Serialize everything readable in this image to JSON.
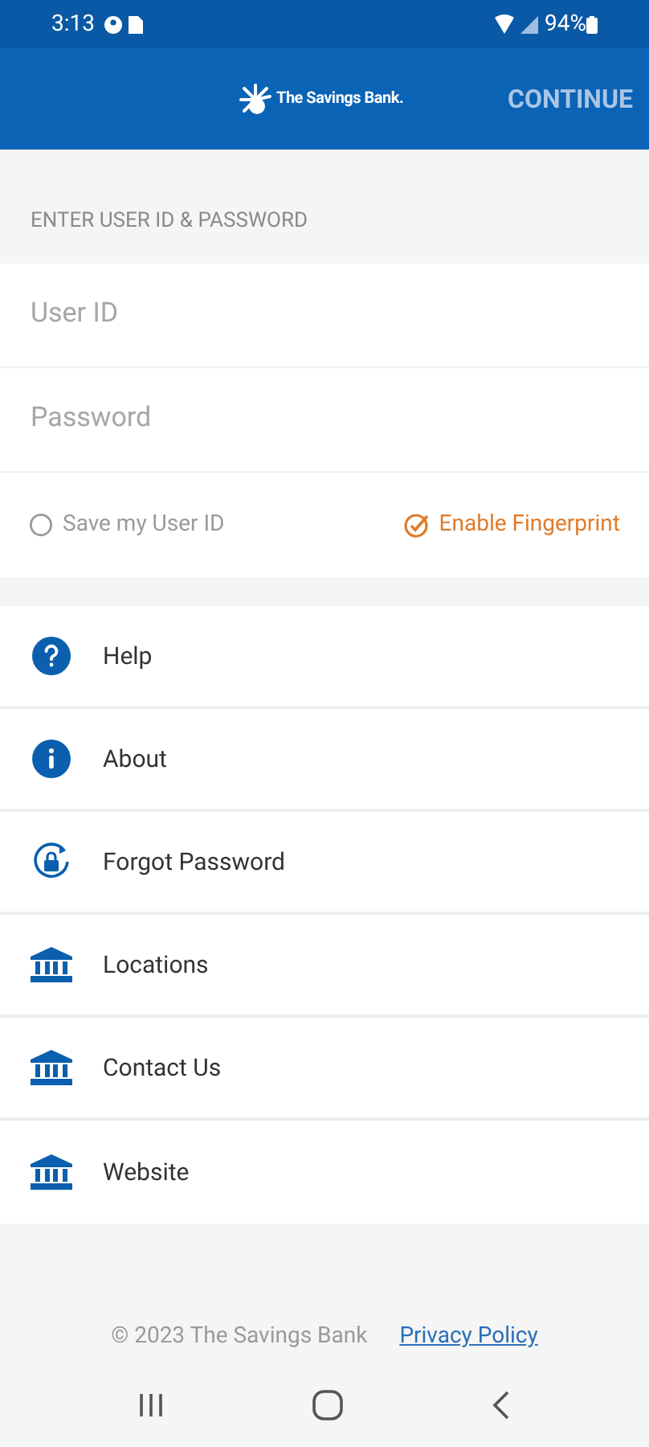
{
  "status_bar": {
    "time": "3:13",
    "battery": "94%"
  },
  "header": {
    "logo_text": "The Savings Bank.",
    "continue_button": "CONTINUE"
  },
  "login": {
    "section_label": "ENTER USER ID & PASSWORD",
    "fields": [
      {
        "placeholder": "User ID"
      },
      {
        "placeholder": "Password"
      }
    ],
    "options": [
      {
        "label": "Save my User ID",
        "checked": false
      },
      {
        "label": "Enable Fingerprint",
        "checked": true
      }
    ]
  },
  "menu": [
    {
      "label": "Help",
      "kind": "help"
    },
    {
      "label": "About",
      "kind": "info"
    },
    {
      "label": "Forgot Password",
      "kind": "lock"
    },
    {
      "label": "Locations",
      "kind": "bank"
    },
    {
      "label": "Contact Us",
      "kind": "bank"
    },
    {
      "label": "Website",
      "kind": "bank"
    }
  ],
  "footer": {
    "copyright": "© 2023 The Savings Bank",
    "link": "Privacy Policy"
  }
}
